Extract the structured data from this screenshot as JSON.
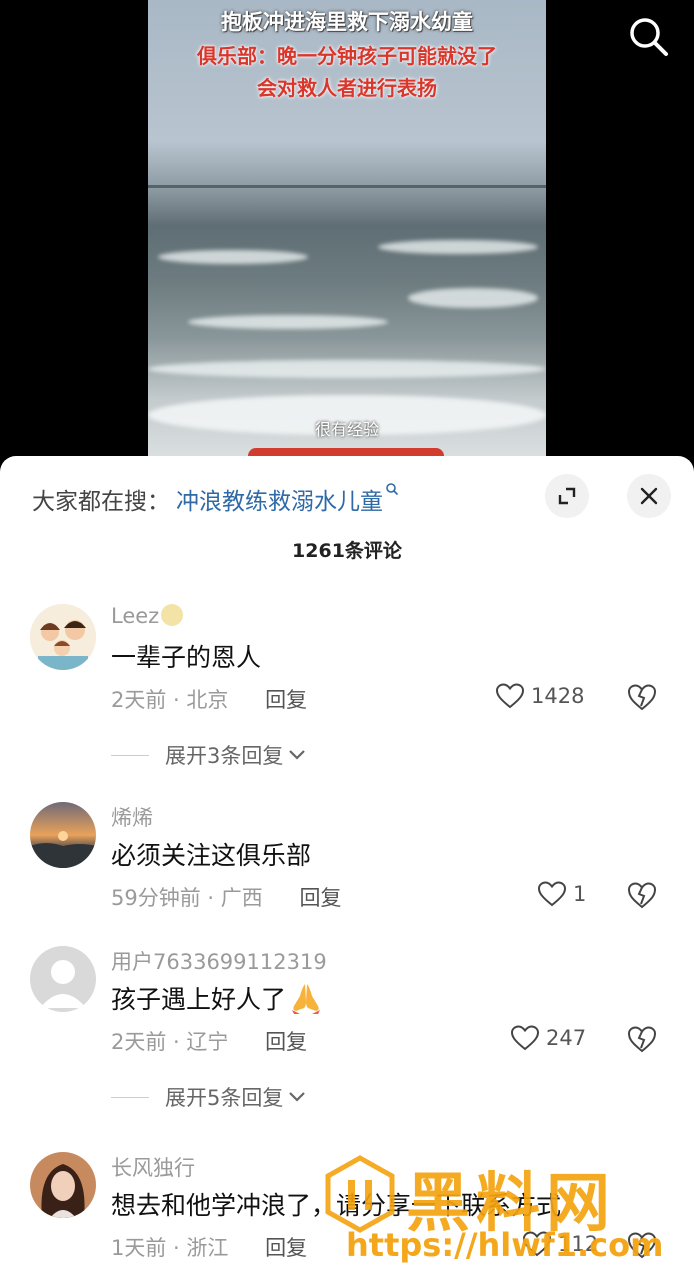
{
  "video": {
    "title_line1": "抱板冲进海里救下溺水幼童",
    "title_line2": "俱乐部：晚一分钟孩子可能就没了",
    "title_line3": "会对救人者进行表扬",
    "subtitle": "很有经验"
  },
  "hot_search": {
    "prefix": "大家都在搜：",
    "query": "冲浪教练救溺水儿童"
  },
  "comment_count": "1261条评论",
  "comments": [
    {
      "user": "Leez",
      "text": "一辈子的恩人",
      "time": "2天前",
      "location": "北京",
      "reply": "回复",
      "likes": "1428",
      "expand": "展开3条回复"
    },
    {
      "user": "烯烯",
      "text": "必须关注这俱乐部",
      "time": "59分钟前",
      "location": "广西",
      "reply": "回复",
      "likes": "1"
    },
    {
      "user": "用户7633699112319",
      "text": "孩子遇上好人了",
      "time": "2天前",
      "location": "辽宁",
      "reply": "回复",
      "likes": "247",
      "expand": "展开5条回复"
    },
    {
      "user": "长风独行",
      "text": "想去和他学冲浪了，请分享一下联系方式",
      "time": "1天前",
      "location": "浙江",
      "reply": "回复",
      "likes": "112"
    }
  ],
  "watermark": {
    "brand": "黑料网",
    "url": "https://hlwf1.com"
  },
  "colors": {
    "link": "#2f6aa6",
    "watermark": "#f4a30f",
    "title_red": "#d9362c"
  },
  "icons": [
    "search-icon",
    "expand-icon",
    "close-icon",
    "heart-icon",
    "broken-heart-icon",
    "chevron-down-icon",
    "pray-emoji-icon",
    "smile-emoji-icon"
  ]
}
